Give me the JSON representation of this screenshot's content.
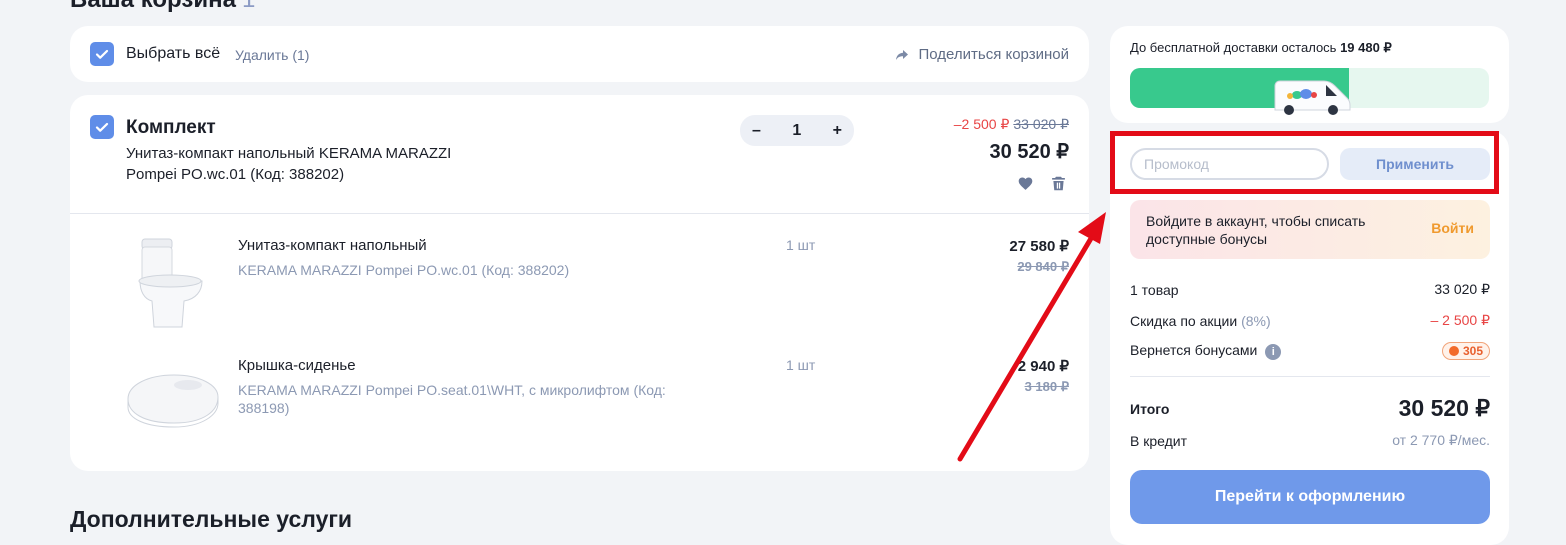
{
  "page": {
    "title": "Ваша корзина",
    "count": "1"
  },
  "select_bar": {
    "select_all_label": "Выбрать всё",
    "delete_label": "Удалить (1)",
    "share_label": "Поделиться корзиной"
  },
  "bundle": {
    "title": "Комплект",
    "description": "Унитаз-компакт напольный KERAMA MARAZZI Pompei PO.wc.01 (Код: 388202)",
    "quantity": "1",
    "minus_label": "–",
    "plus_label": "+",
    "discount": "–2 500 ₽",
    "old_price": "33 020 ₽",
    "price": "30 520 ₽",
    "items": [
      {
        "name": "Унитаз-компакт напольный",
        "code": "KERAMA MARAZZI Pompei PO.wc.01 (Код: 388202)",
        "qty": "1 шт",
        "price": "27 580 ₽",
        "old_price": "29 840 ₽"
      },
      {
        "name": "Крышка-сиденье",
        "code": "KERAMA MARAZZI Pompei PO.seat.01\\WHT, с микролифтом (Код: 388198)",
        "qty": "1 шт",
        "price": "2 940 ₽",
        "old_price": "3 180 ₽"
      }
    ]
  },
  "services": {
    "title": "Дополнительные услуги"
  },
  "delivery": {
    "text": "До бесплатной доставки осталось",
    "amount": "19 480 ₽",
    "progress_fraction": 0.61
  },
  "promo": {
    "placeholder": "Промокод",
    "apply_label": "Применить"
  },
  "login_hint": {
    "text": "Войдите в аккаунт, чтобы списать доступные бонусы",
    "link": "Войти"
  },
  "summary": {
    "items_label": "1 товар",
    "items_value": "33 020 ₽",
    "discount_label": "Скидка по акции",
    "discount_pct": "(8%)",
    "discount_value": "– 2 500 ₽",
    "bonus_label": "Вернется бонусами",
    "bonus_value": "305",
    "total_label": "Итого",
    "total_value": "30 520 ₽",
    "credit_label": "В кредит",
    "credit_value": "от 2 770 ₽/мес.",
    "checkout_label": "Перейти к оформлению"
  },
  "colors": {
    "accent": "#5f8de8",
    "discount": "#e84545",
    "highlight": "#e30b17",
    "progress": "#38c98d"
  }
}
